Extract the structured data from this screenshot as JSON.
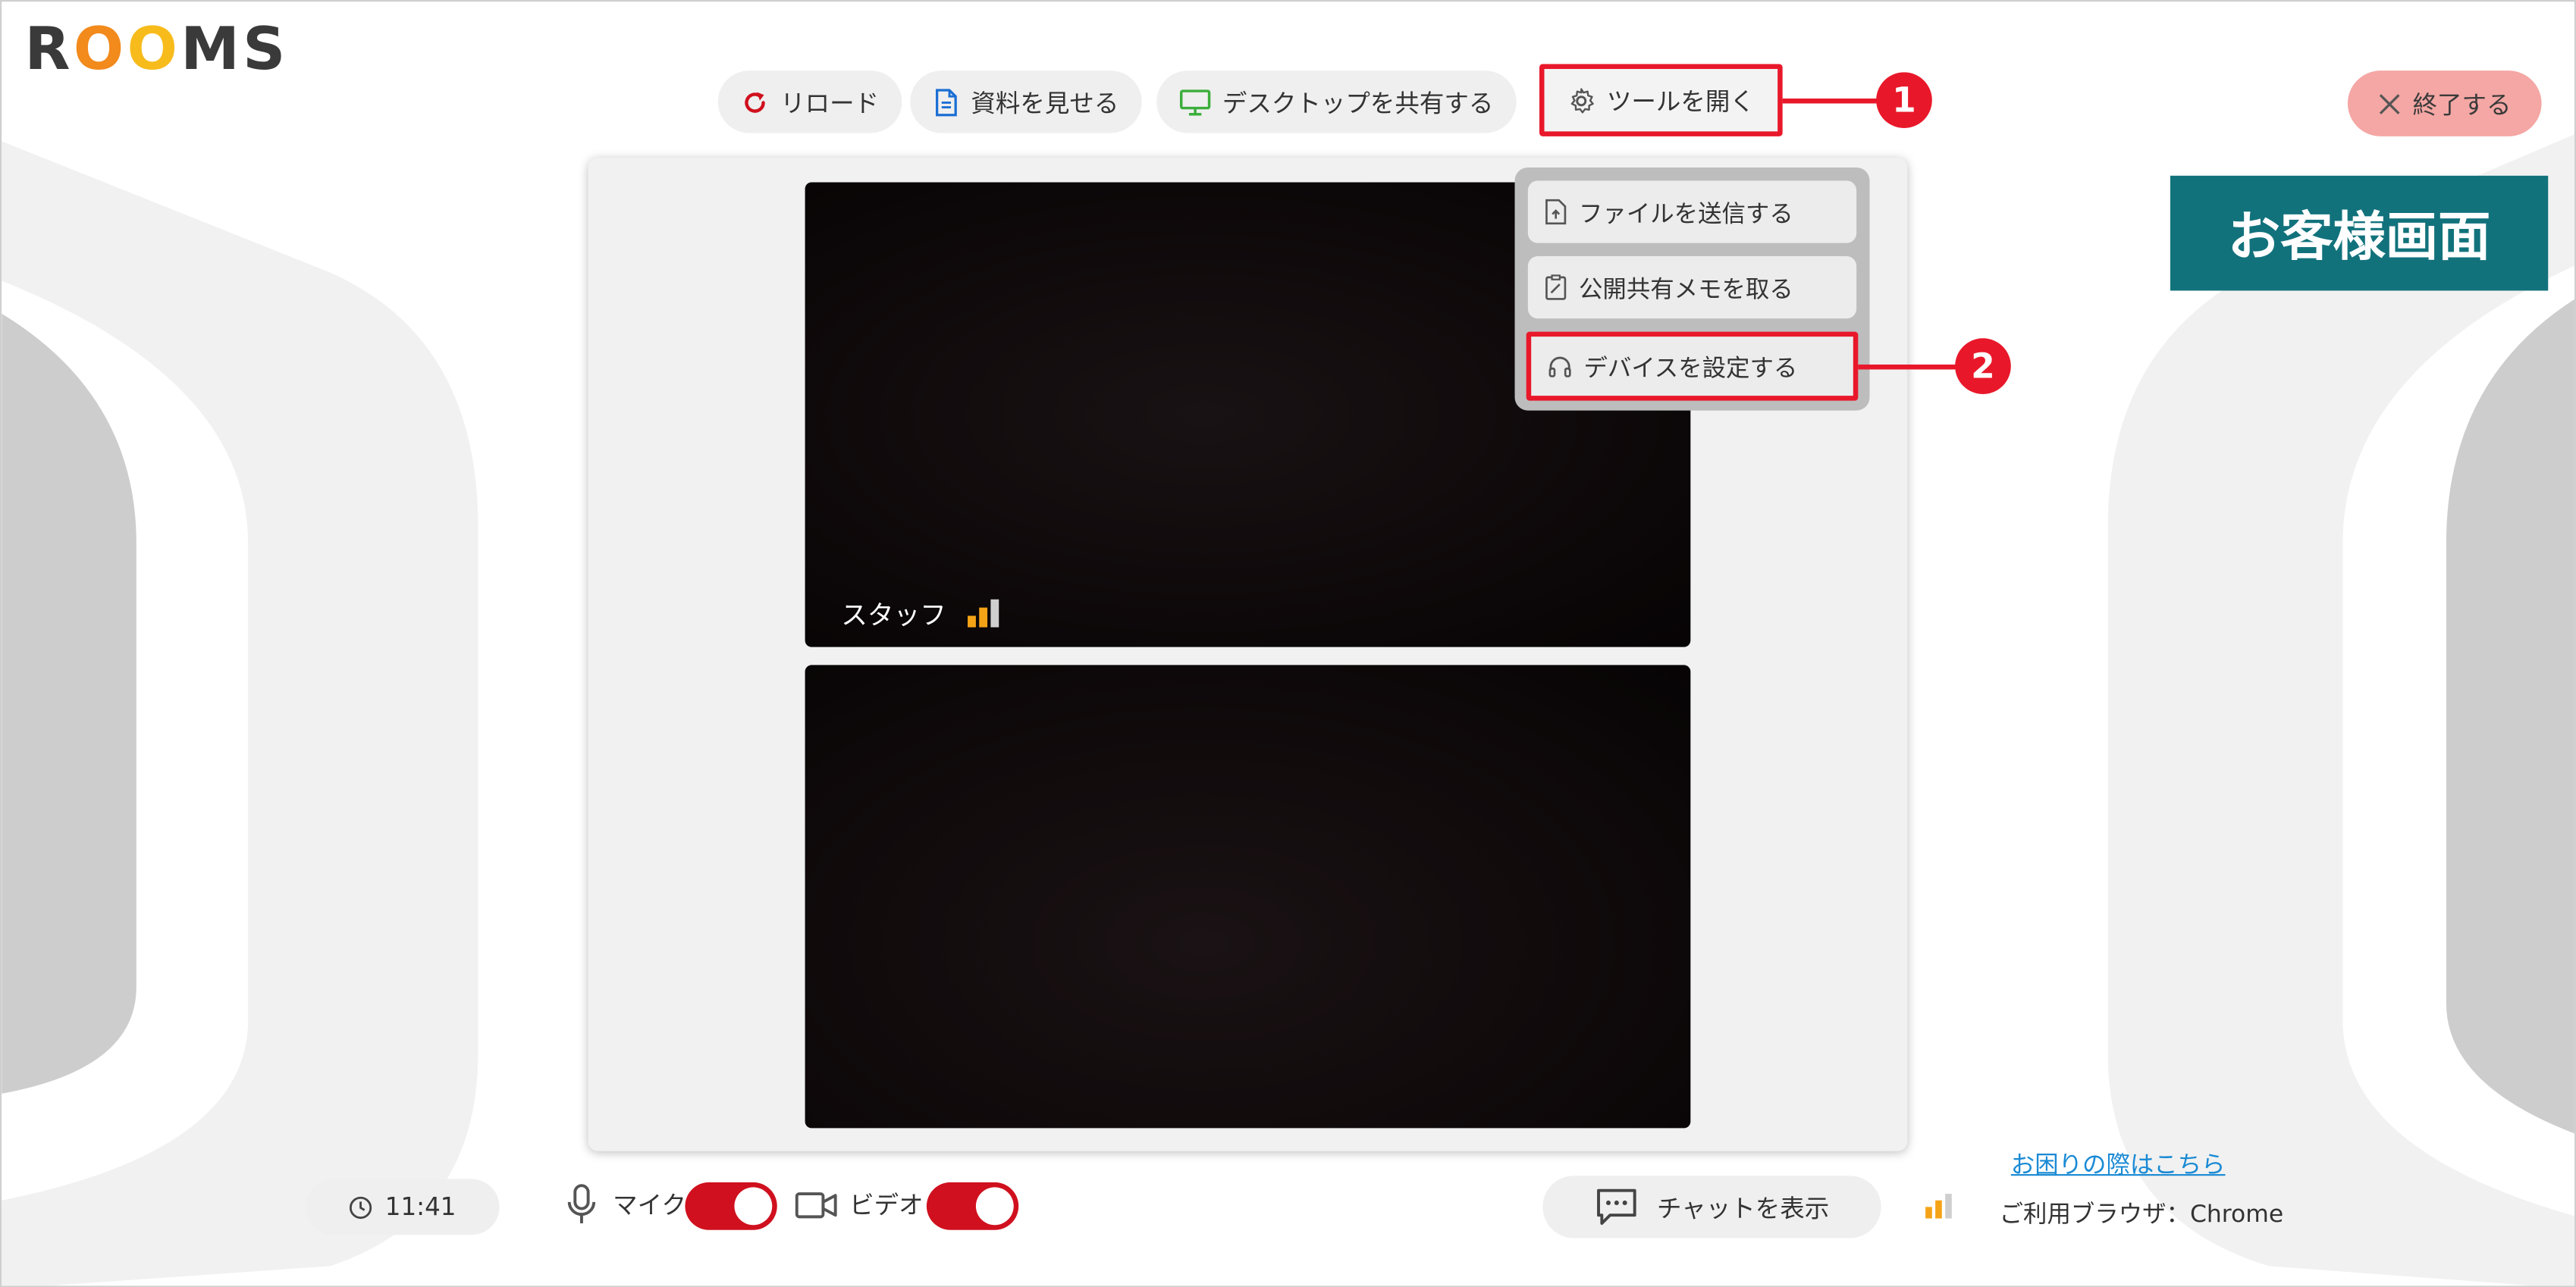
{
  "app": {
    "logo": {
      "letters": [
        "R",
        "O",
        "O",
        "MS"
      ]
    },
    "colors": {
      "accent_red": "#e8182a",
      "toggle_red": "#d0101e",
      "teal": "#12727c",
      "end_button": "#f4a7a4",
      "logo_orange": "#f28a1c",
      "logo_yellow": "#f7bb1c"
    }
  },
  "toolbar": {
    "reload": {
      "label": "リロード",
      "icon": "reload-icon"
    },
    "show_document": {
      "label": "資料を見せる",
      "icon": "document-icon"
    },
    "share_desktop": {
      "label": "デスクトップを共有する",
      "icon": "monitor-icon"
    },
    "open_tools": {
      "label": "ツールを開く",
      "icon": "gear-icon"
    }
  },
  "end_button": {
    "label": "終了する",
    "icon": "close-icon"
  },
  "view_label": "お客様画面",
  "tools_menu": {
    "items": [
      {
        "label": "ファイルを送信する",
        "icon": "file-upload-icon"
      },
      {
        "label": "公開共有メモを取る",
        "icon": "memo-icon"
      },
      {
        "label": "デバイスを設定する",
        "icon": "headset-icon"
      }
    ]
  },
  "videos": {
    "staff": {
      "label": "スタッフ",
      "signal_icon": "signal-strength-icon"
    }
  },
  "annotations": {
    "step1": "1",
    "step2": "2"
  },
  "bottom_bar": {
    "time": "11:41",
    "mic": {
      "label": "マイク",
      "on": true
    },
    "video": {
      "label": "ビデオ",
      "on": true
    },
    "chat": {
      "label": "チャットを表示",
      "icon": "chat-icon"
    },
    "help_link": "お困りの際はこちら",
    "browser": "ご利用ブラウザ：Chrome"
  }
}
